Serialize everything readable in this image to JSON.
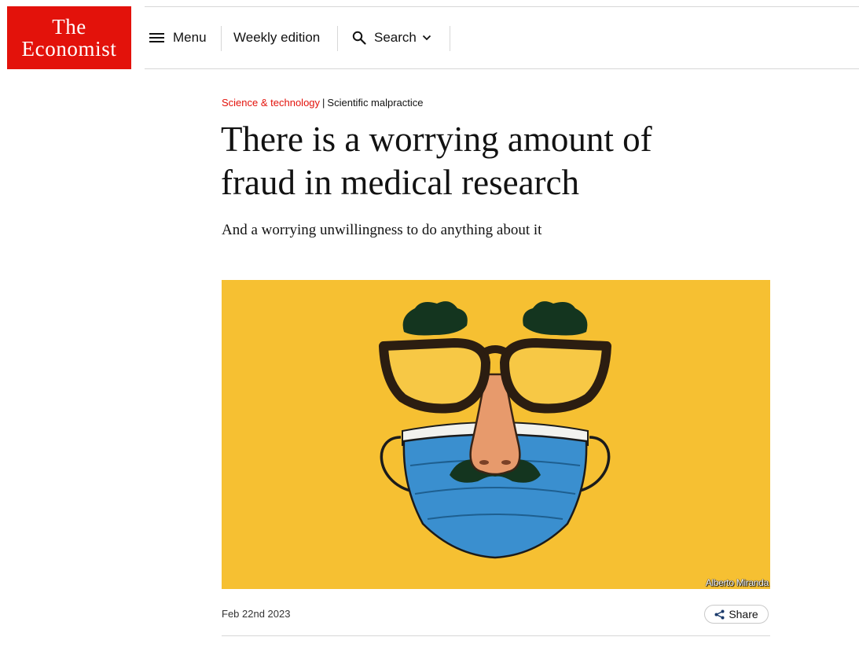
{
  "header": {
    "logo_line1": "The",
    "logo_line2": "Economist",
    "menu_label": "Menu",
    "weekly_label": "Weekly edition",
    "search_label": "Search"
  },
  "article": {
    "section": "Science & technology",
    "separator": "|",
    "topic": "Scientific malpractice",
    "headline_line1": "There is a worrying amount of",
    "headline_line2": "fraud in medical research",
    "subheadline": "And a worrying unwillingness to do anything about it",
    "image_credit": "Alberto Miranda",
    "date": "Feb 22nd 2023",
    "share_label": "Share"
  },
  "colors": {
    "brand_red": "#e3120b",
    "illustration_background": "#f6c032",
    "mask_blue": "#3a8fcf"
  },
  "icons": {
    "menu": "hamburger-icon",
    "search": "magnifier-icon",
    "dropdown": "chevron-down-icon",
    "share": "share-icon"
  }
}
